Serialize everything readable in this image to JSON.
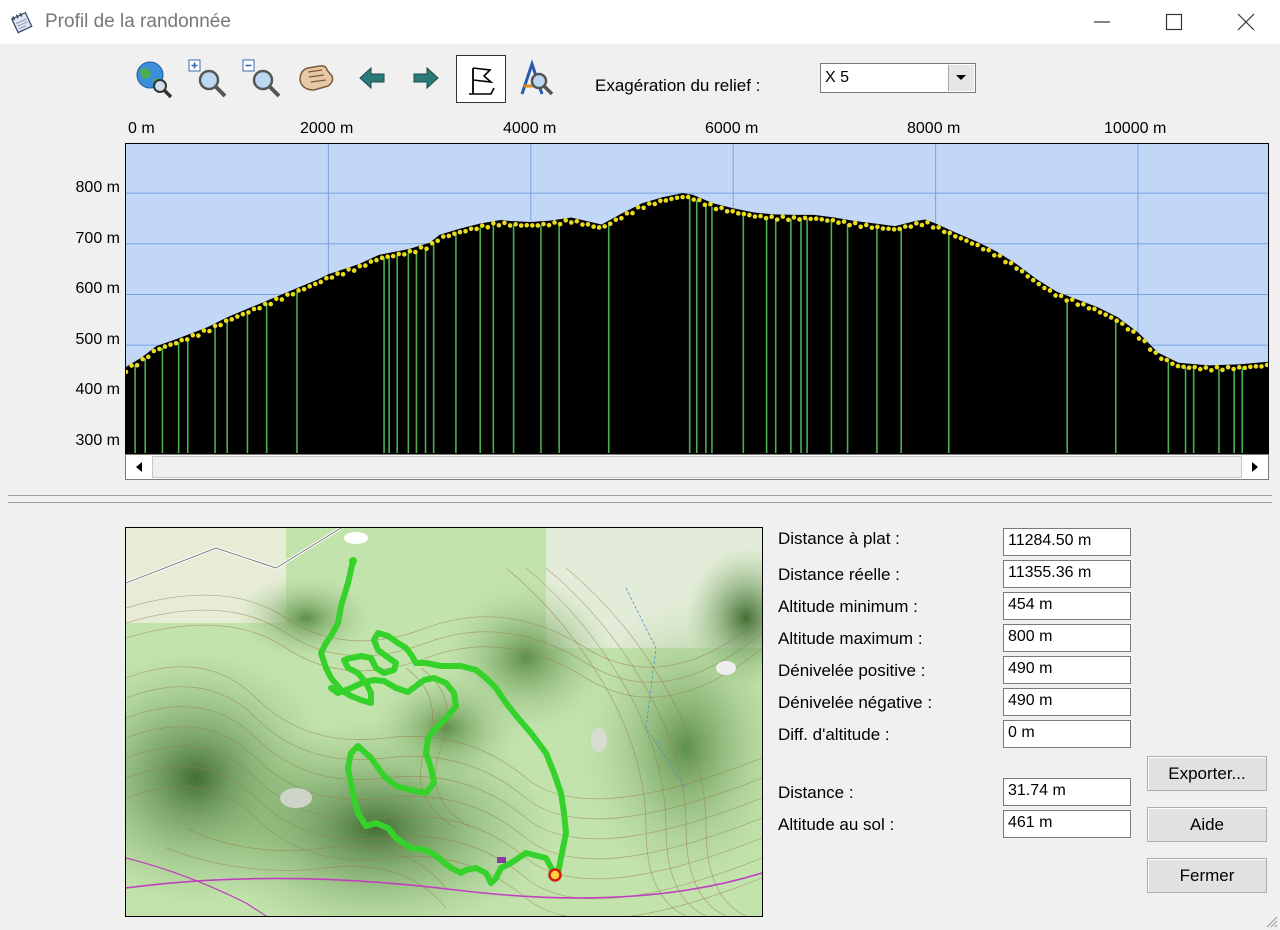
{
  "window": {
    "title": "Profil de la randonnée",
    "icon": "notepad-icon"
  },
  "toolbar": {
    "relief_label": "Exagération du relief :",
    "relief_value": "X 5",
    "buttons": [
      "globe-search-icon",
      "zoom-in-icon",
      "zoom-out-icon",
      "pan-hand-icon",
      "arrow-left-icon",
      "arrow-right-icon",
      "flag-marker-icon",
      "compass-search-icon"
    ]
  },
  "chart_data": {
    "type": "area",
    "x_tick_labels": [
      "0 m",
      "2000 m",
      "4000 m",
      "6000 m",
      "8000 m",
      "10000 m"
    ],
    "y_tick_labels": [
      "800 m",
      "700 m",
      "600 m",
      "500 m",
      "400 m",
      "300 m"
    ],
    "x_unit": "m",
    "y_unit": "m",
    "xlim": [
      0,
      11284.5
    ],
    "ylim": [
      287,
      897
    ],
    "grid": true,
    "colors": {
      "sky": "#c2d6f5",
      "terrain": "#000000",
      "grid": "#7aa3e0",
      "markers": "#e8dc1e",
      "points": "#4caf50"
    },
    "x": [
      0,
      150,
      300,
      500,
      800,
      1000,
      1300,
      1600,
      1900,
      2000,
      2300,
      2500,
      2800,
      3000,
      3100,
      3300,
      3500,
      3700,
      3800,
      4000,
      4200,
      4400,
      4700,
      4900,
      5100,
      5300,
      5500,
      5600,
      5800,
      6000,
      6200,
      6400,
      6600,
      6800,
      7000,
      7200,
      7400,
      7600,
      7800,
      7900,
      8000,
      8200,
      8400,
      8600,
      8800,
      9000,
      9200,
      9400,
      9600,
      9800,
      10000,
      10200,
      10400,
      10700,
      11000,
      11284.5
    ],
    "y": [
      457,
      475,
      498,
      512,
      535,
      555,
      580,
      605,
      630,
      640,
      660,
      678,
      690,
      702,
      718,
      730,
      740,
      747,
      745,
      743,
      746,
      752,
      738,
      760,
      780,
      792,
      800,
      797,
      780,
      770,
      762,
      758,
      757,
      757,
      752,
      745,
      740,
      735,
      745,
      748,
      740,
      722,
      705,
      685,
      660,
      630,
      605,
      590,
      575,
      555,
      525,
      485,
      465,
      460,
      462,
      467
    ],
    "point_positions_m": [
      90,
      190,
      360,
      520,
      610,
      880,
      1000,
      1200,
      1390,
      1690,
      2550,
      2600,
      2680,
      2790,
      2870,
      2960,
      3040,
      3260,
      3500,
      3630,
      3830,
      4100,
      4280,
      4770,
      5570,
      5640,
      5730,
      5790,
      6100,
      6330,
      6420,
      6570,
      6670,
      6730,
      6970,
      7130,
      7420,
      7660,
      8130,
      9300,
      9780,
      10300,
      10470,
      10550,
      10800,
      10950,
      11030
    ]
  },
  "stats": [
    {
      "label": "Distance à plat :",
      "value": "11284.50 m"
    },
    {
      "label": "Distance réelle :",
      "value": "11355.36 m"
    },
    {
      "label": "Altitude minimum :",
      "value": "454 m"
    },
    {
      "label": "Altitude maximum :",
      "value": "800 m"
    },
    {
      "label": "Dénivelée positive :",
      "value": "490 m"
    },
    {
      "label": "Dénivelée négative :",
      "value": "490 m"
    },
    {
      "label": "Diff. d'altitude :",
      "value": "0 m"
    }
  ],
  "cursor": [
    {
      "label": "Distance :",
      "value": "31.74 m"
    },
    {
      "label": "Altitude au sol :",
      "value": "461 m"
    }
  ],
  "buttons": {
    "export": "Exporter...",
    "help": "Aide",
    "close": "Fermer"
  }
}
